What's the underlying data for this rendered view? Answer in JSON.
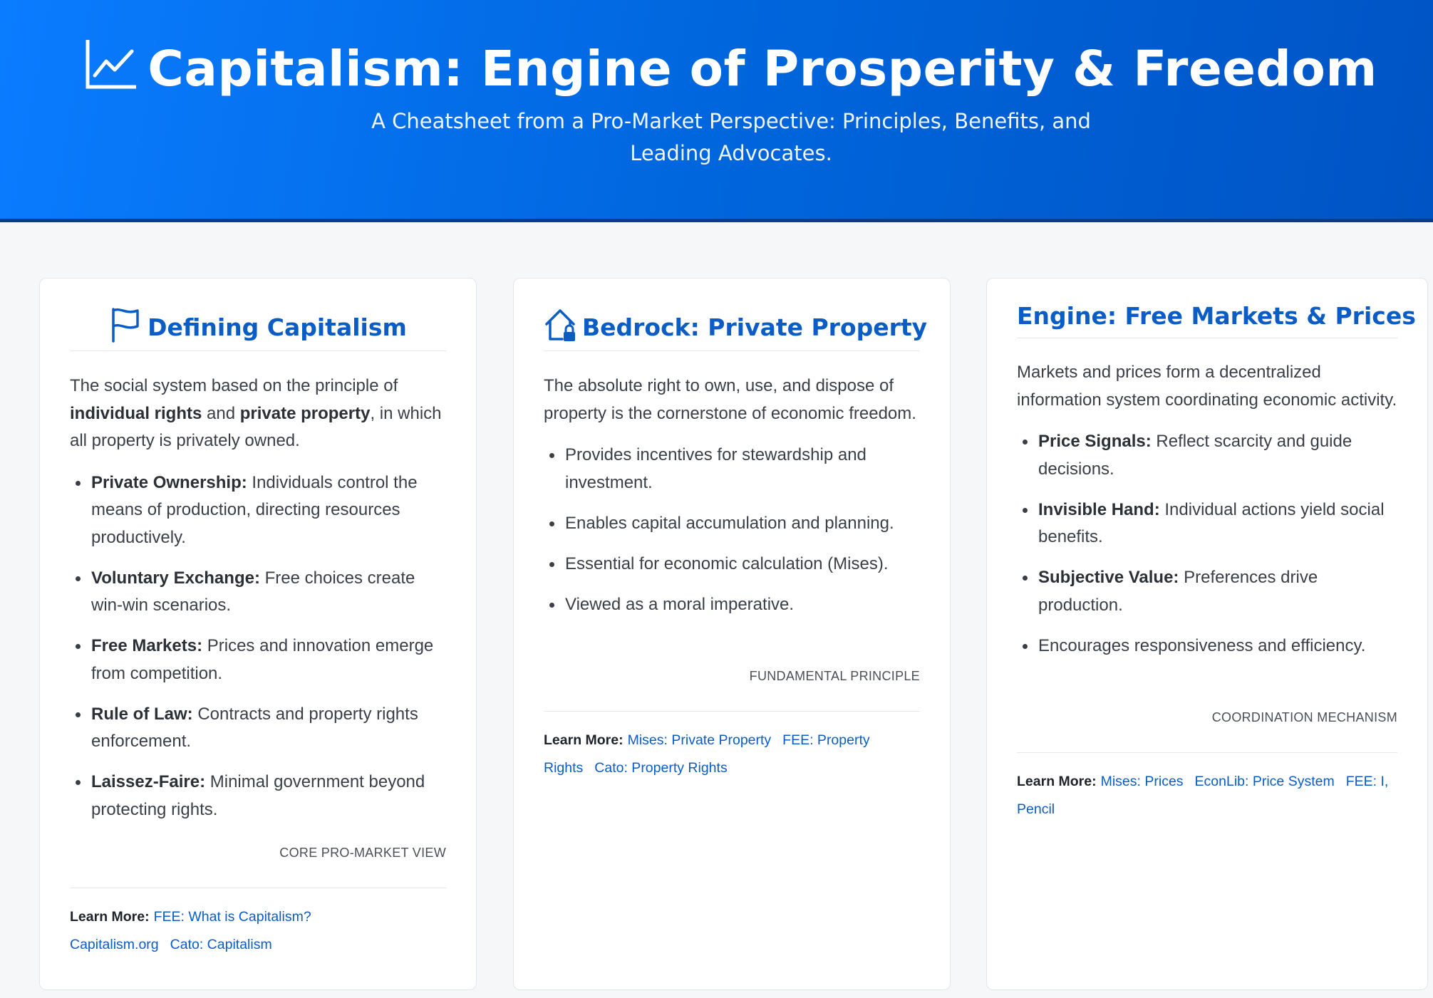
{
  "header": {
    "icon": "chart-line-icon",
    "title": "Capitalism: Engine of Prosperity & Freedom",
    "subtitle": "A Cheatsheet from a Pro-Market Perspective: Principles, Benefits, and Leading Advocates."
  },
  "colors": {
    "header_gradient_start": "#0a7cff",
    "header_gradient_end": "#0054c4",
    "accent": "#0b5cc4",
    "page_background": "#f6f7f9"
  },
  "learn_label": "Learn More:",
  "cards": [
    {
      "icon": "flag-icon",
      "title": "Defining Capitalism",
      "intro_parts": [
        "The social system based on the principle of ",
        "individual rights",
        " and ",
        "private property",
        ", in which all property is privately owned."
      ],
      "bullets": [
        {
          "term": "Private Ownership:",
          "text": " Individuals control the means of production, directing resources productively."
        },
        {
          "term": "Voluntary Exchange:",
          "text": " Free choices create win-win scenarios."
        },
        {
          "term": "Free Markets:",
          "text": " Prices and innovation emerge from competition."
        },
        {
          "term": "Rule of Law:",
          "text": " Contracts and property rights enforcement."
        },
        {
          "term": "Laissez-Faire:",
          "text": " Minimal government beyond protecting rights."
        }
      ],
      "tag": "CORE PRO-MARKET VIEW",
      "links": [
        "FEE: What is Capitalism?",
        "Capitalism.org",
        "Cato: Capitalism"
      ]
    },
    {
      "icon": "house-lock-icon",
      "title": "Bedrock: Private Property",
      "intro": "The absolute right to own, use, and dispose of property is the cornerstone of economic freedom.",
      "bullets": [
        {
          "text": "Provides incentives for stewardship and investment."
        },
        {
          "text": "Enables capital accumulation and planning."
        },
        {
          "text": "Essential for economic calculation (Mises)."
        },
        {
          "text": "Viewed as a moral imperative."
        }
      ],
      "tag": "FUNDAMENTAL PRINCIPLE",
      "links": [
        "Mises: Private Property",
        "FEE: Property Rights",
        "Cato: Property Rights"
      ]
    },
    {
      "title": "Engine: Free Markets & Prices",
      "intro": "Markets and prices form a decentralized information system coordinating economic activity.",
      "bullets": [
        {
          "term": "Price Signals:",
          "text": " Reflect scarcity and guide decisions."
        },
        {
          "term": "Invisible Hand:",
          "text": " Individual actions yield social benefits."
        },
        {
          "term": "Subjective Value:",
          "text": " Preferences drive production."
        },
        {
          "text": "Encourages responsiveness and efficiency."
        }
      ],
      "tag": "COORDINATION MECHANISM",
      "links": [
        "Mises: Prices",
        "EconLib: Price System",
        "FEE: I, Pencil"
      ]
    }
  ]
}
